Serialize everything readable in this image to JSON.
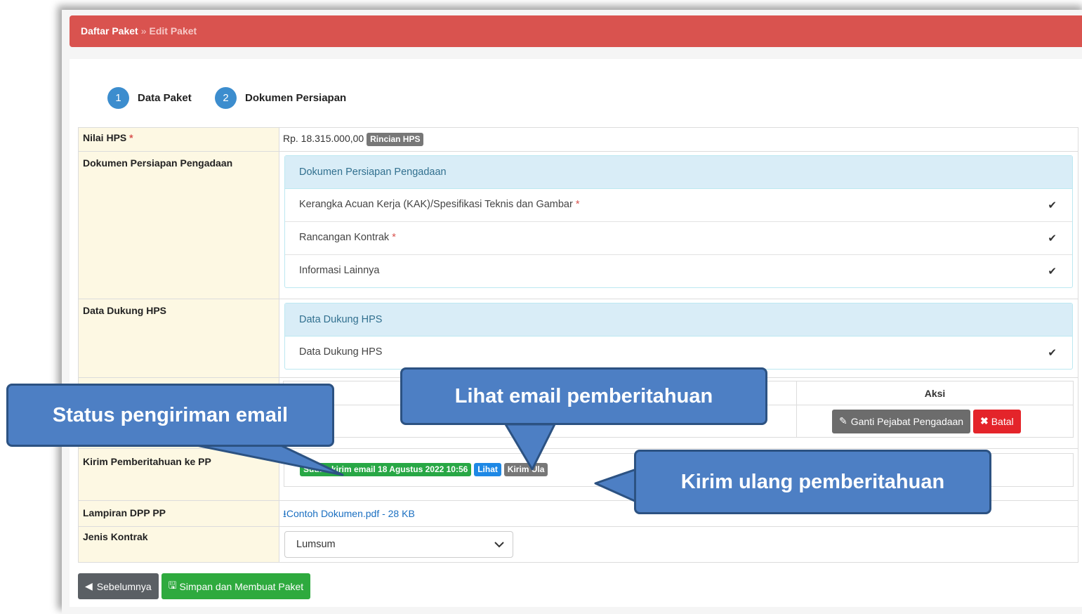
{
  "breadcrumb": {
    "root": "Daftar Paket",
    "separator": "»",
    "current": "Edit Paket"
  },
  "steps": [
    {
      "number": "1",
      "label": "Data Paket"
    },
    {
      "number": "2",
      "label": "Dokumen Persiapan"
    }
  ],
  "form": {
    "nilai_hps": {
      "label": "Nilai HPS",
      "required_mark": "*",
      "value": "Rp. 18.315.000,00",
      "badge": "Rincian HPS"
    },
    "dokumen_persiapan": {
      "label": "Dokumen Persiapan Pengadaan",
      "panel_title": "Dokumen Persiapan Pengadaan",
      "items": [
        {
          "text": "Kerangka Acuan Kerja (KAK)/Spesifikasi Teknis dan Gambar",
          "required_mark": "*"
        },
        {
          "text": "Rancangan Kontrak",
          "required_mark": "*"
        },
        {
          "text": "Informasi Lainnya",
          "required_mark": ""
        }
      ]
    },
    "data_dukung": {
      "label": "Data Dukung HPS",
      "panel_title": "Data Dukung HPS",
      "items": [
        {
          "text": "Data Dukung HPS"
        }
      ]
    },
    "pejabat": {
      "aksi_header": "Aksi",
      "ganti_button": "Ganti Pejabat Pengadaan",
      "batal_button": "Batal"
    },
    "kirim_pemberitahuan": {
      "label": "Kirim Pemberitahuan ke PP",
      "status_badge": "Sudah kirim email 18 Agustus 2022 10:56",
      "lihat_badge": "Lihat",
      "kirim_ulang_badge": "Kirim Ula"
    },
    "lampiran": {
      "label": "Lampiran DPP PP",
      "file_link": "Contoh Dokumen.pdf - 28 KB"
    },
    "jenis_kontrak": {
      "label": "Jenis Kontrak",
      "selected": "Lumsum"
    }
  },
  "footer": {
    "back_button": "Sebelumnya",
    "save_button": "Simpan dan Membuat Paket"
  },
  "callouts": {
    "status": "Status pengiriman email",
    "lihat": "Lihat email pemberitahuan",
    "kirim_ulang": "Kirim ulang pemberitahuan"
  },
  "icons": {
    "check": "check-icon",
    "download": "download-icon",
    "edit": "edit-icon",
    "close": "close-icon",
    "back": "arrow-circle-left-icon",
    "save": "save-icon",
    "chevron": "chevron-down-icon"
  },
  "colors": {
    "header": "#d9534f",
    "step": "#3c8dce",
    "callout": "#4d7fc4",
    "success": "#28a745",
    "info": "#1e88e5",
    "danger": "#e4242a"
  }
}
